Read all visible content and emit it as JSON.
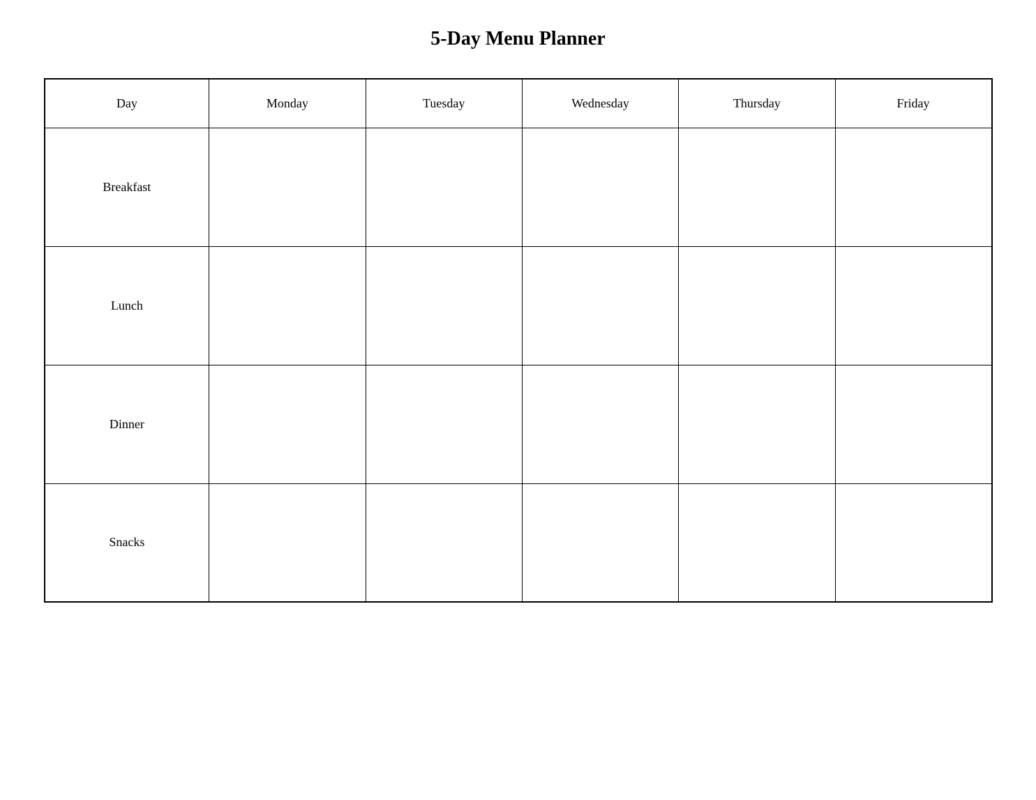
{
  "title": "5-Day Menu Planner",
  "headers": {
    "day": "Day",
    "monday": "Monday",
    "tuesday": "Tuesday",
    "wednesday": "Wednesday",
    "thursday": "Thursday",
    "friday": "Friday"
  },
  "rows": [
    {
      "label": "Breakfast"
    },
    {
      "label": "Lunch"
    },
    {
      "label": "Dinner"
    },
    {
      "label": "Snacks"
    }
  ]
}
